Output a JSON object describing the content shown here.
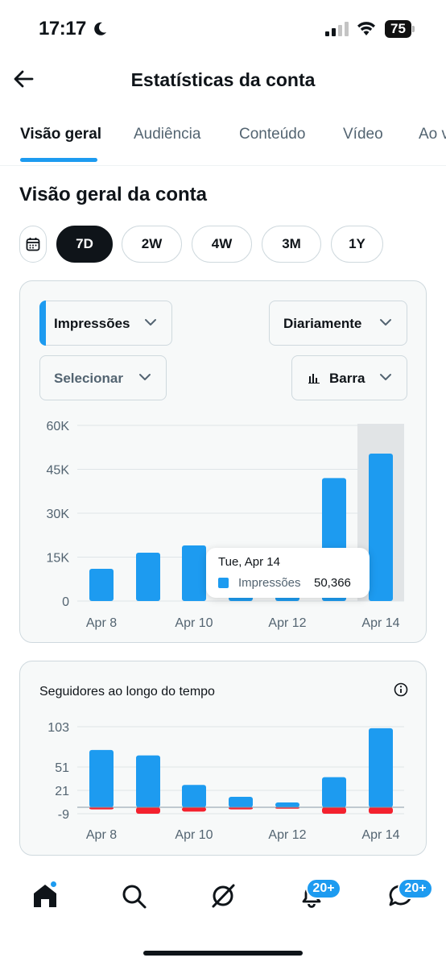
{
  "status_bar": {
    "time": "17:17",
    "battery": "75",
    "icons": [
      "moon-icon",
      "signal-icon",
      "wifi-icon",
      "battery-icon"
    ]
  },
  "header": {
    "title": "Estatísticas da conta",
    "back_icon": "arrow-left-icon"
  },
  "tabs": [
    {
      "label": "Visão geral",
      "active": true
    },
    {
      "label": "Audiência",
      "active": false
    },
    {
      "label": "Conteúdo",
      "active": false
    },
    {
      "label": "Vídeo",
      "active": false
    },
    {
      "label": "Ao v",
      "active": false
    }
  ],
  "overview": {
    "title": "Visão geral da conta",
    "calendar_icon": "calendar-icon",
    "ranges": [
      {
        "label": "7D",
        "active": true
      },
      {
        "label": "2W",
        "active": false
      },
      {
        "label": "4W",
        "active": false
      },
      {
        "label": "3M",
        "active": false
      },
      {
        "label": "1Y",
        "active": false
      }
    ]
  },
  "impressions_card": {
    "metric_dropdown": "Impressões",
    "interval_dropdown": "Diariamente",
    "compare_dropdown": "Selecionar",
    "chart_type_dropdown": "Barra",
    "tooltip": {
      "date": "Tue, Apr 14",
      "series": "Impressões",
      "value": "50,366"
    }
  },
  "followers_card": {
    "title": "Seguidores ao longo do tempo",
    "info_icon": "info-icon"
  },
  "chart_data": [
    {
      "type": "bar",
      "title": "",
      "categories": [
        "Apr 8",
        "Apr 9",
        "Apr 10",
        "Apr 11",
        "Apr 12",
        "Apr 13",
        "Apr 14"
      ],
      "x_tick_labels": [
        "Apr 8",
        "Apr 10",
        "Apr 12",
        "Apr 14"
      ],
      "series": [
        {
          "name": "Impressões",
          "color": "#1d9bf0",
          "values": [
            11000,
            16500,
            19000,
            5000,
            5000,
            42000,
            50366
          ]
        }
      ],
      "y_ticks": [
        "60K",
        "45K",
        "30K",
        "15K",
        "0"
      ],
      "ylim": [
        0,
        60000
      ],
      "highlighted_category": "Apr 14",
      "grid": true
    },
    {
      "type": "bar",
      "title": "Seguidores ao longo do tempo",
      "categories": [
        "Apr 8",
        "Apr 9",
        "Apr 10",
        "Apr 11",
        "Apr 12",
        "Apr 13",
        "Apr 14"
      ],
      "x_tick_labels": [
        "Apr 8",
        "Apr 10",
        "Apr 12",
        "Apr 14"
      ],
      "series": [
        {
          "color": "#1d9bf0",
          "values": [
            73,
            66,
            28,
            13,
            6,
            38,
            101
          ]
        },
        {
          "color": "#f4212e",
          "values": [
            -3,
            -9,
            -6,
            -3,
            -2,
            -9,
            -9
          ]
        }
      ],
      "y_ticks": [
        "103",
        "51",
        "21",
        "-9"
      ],
      "ylim": [
        -9,
        103
      ],
      "grid": true
    }
  ],
  "bottom_nav": {
    "items": [
      "home-icon",
      "search-icon",
      "grok-icon",
      "notifications-icon",
      "messages-icon"
    ],
    "notifications_badge": "20+",
    "messages_badge": "20+"
  }
}
